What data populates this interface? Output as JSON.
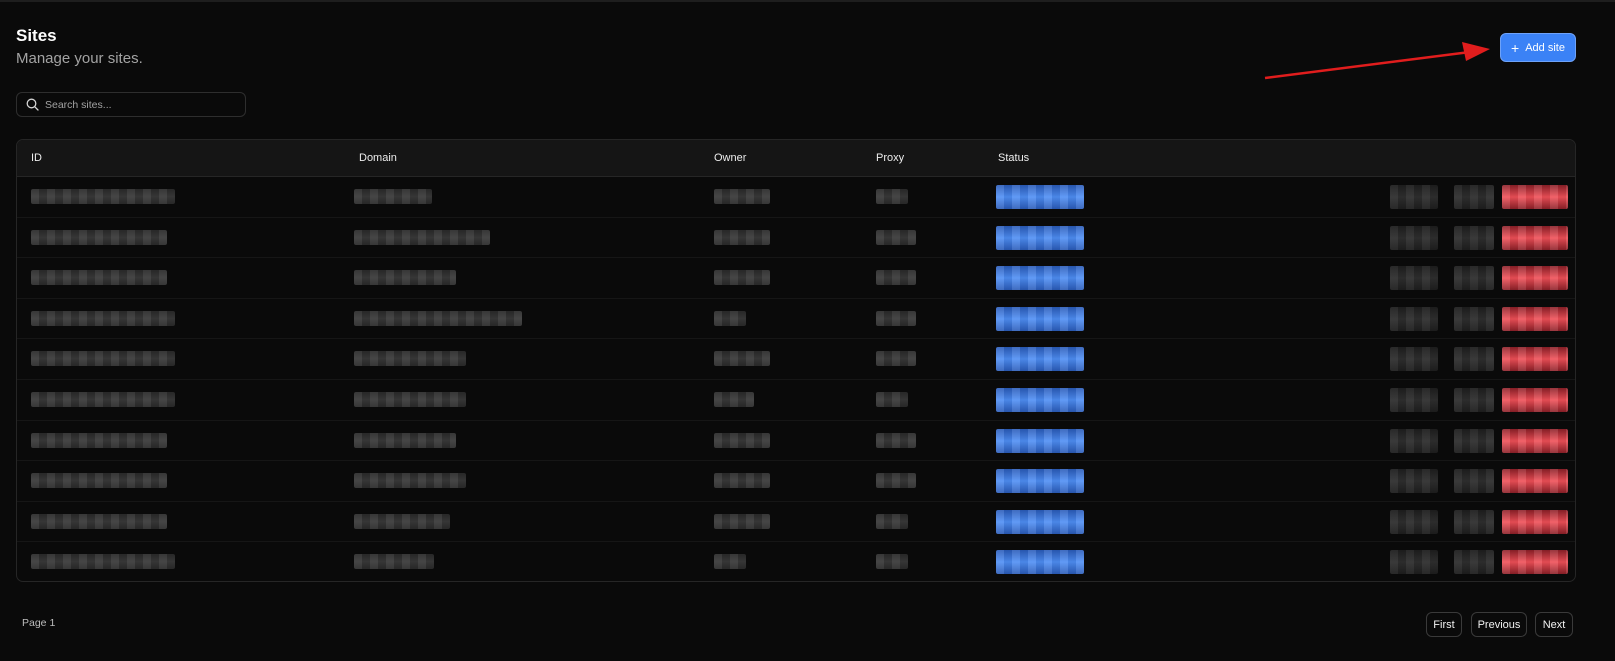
{
  "header": {
    "title": "Sites",
    "subtitle": "Manage your sites.",
    "add_button_label": "Add site",
    "add_button_icon": "plus-icon",
    "accent_color": "#3b82f6"
  },
  "search": {
    "placeholder": "Search sites...",
    "value": "",
    "icon": "search-icon"
  },
  "table": {
    "columns": [
      "ID",
      "Domain",
      "Owner",
      "Proxy",
      "Status"
    ],
    "row_count": 10,
    "note_redacted": true
  },
  "pagination": {
    "page_label": "Page 1",
    "first_label": "First",
    "previous_label": "Previous",
    "next_label": "Next"
  },
  "colors": {
    "status_badge": "#3b82f6",
    "delete_action": "#ef4444",
    "annotation_arrow": "#e11d1d"
  }
}
